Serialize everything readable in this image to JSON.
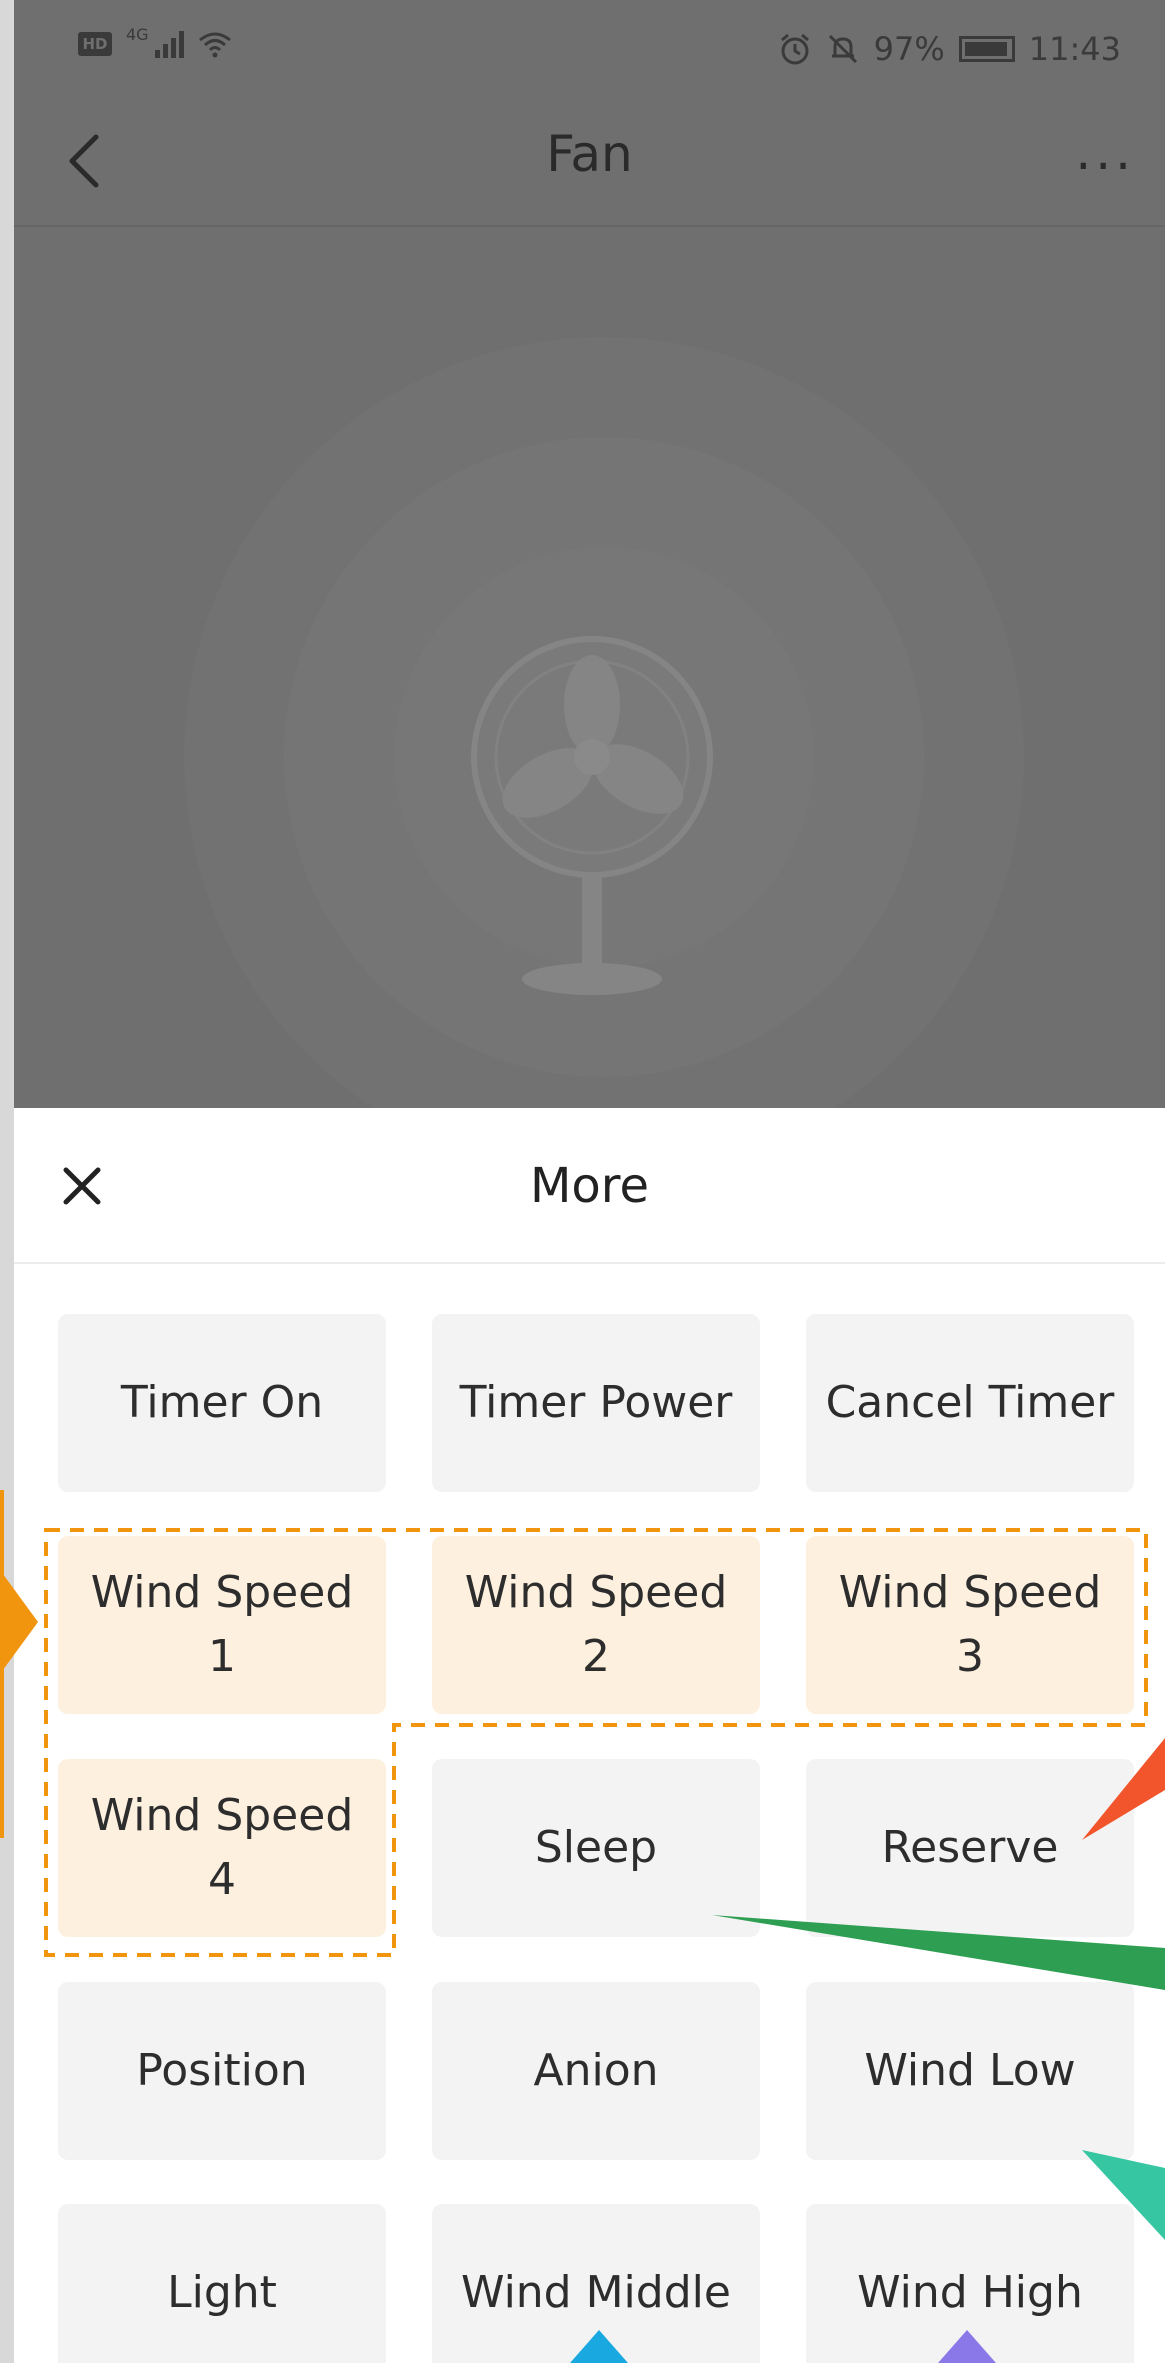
{
  "status_bar": {
    "hd_label": "HD",
    "network": "4G",
    "battery_percent": "97%",
    "time": "11:43"
  },
  "nav": {
    "title": "Fan",
    "more_label": "..."
  },
  "sheet": {
    "title": "More",
    "tiles": [
      {
        "label": "Timer On",
        "highlight": false
      },
      {
        "label": "Timer Power",
        "highlight": false
      },
      {
        "label": "Cancel Timer",
        "highlight": false
      },
      {
        "label": "Wind Speed\n1",
        "highlight": true
      },
      {
        "label": "Wind Speed\n2",
        "highlight": true
      },
      {
        "label": "Wind Speed\n3",
        "highlight": true
      },
      {
        "label": "Wind Speed\n4",
        "highlight": true
      },
      {
        "label": "Sleep",
        "highlight": false
      },
      {
        "label": "Reserve",
        "highlight": false
      },
      {
        "label": "Position",
        "highlight": false
      },
      {
        "label": "Anion",
        "highlight": false
      },
      {
        "label": "Wind Low",
        "highlight": false
      },
      {
        "label": "Light",
        "highlight": false
      },
      {
        "label": "Wind Middle",
        "highlight": false
      },
      {
        "label": "Wind High",
        "highlight": false
      }
    ]
  },
  "colors": {
    "dim_overlay": "#6f6f6f",
    "highlight_fill": "#fdf0df",
    "dash_orange": "#f0950d",
    "arrow_orange": "#f0950d",
    "arrow_red": "#f2552c",
    "arrow_green": "#2e9e52",
    "arrow_teal": "#36c6a2",
    "arrow_cyan": "#1aa8e0",
    "arrow_purple": "#8b78e8"
  }
}
